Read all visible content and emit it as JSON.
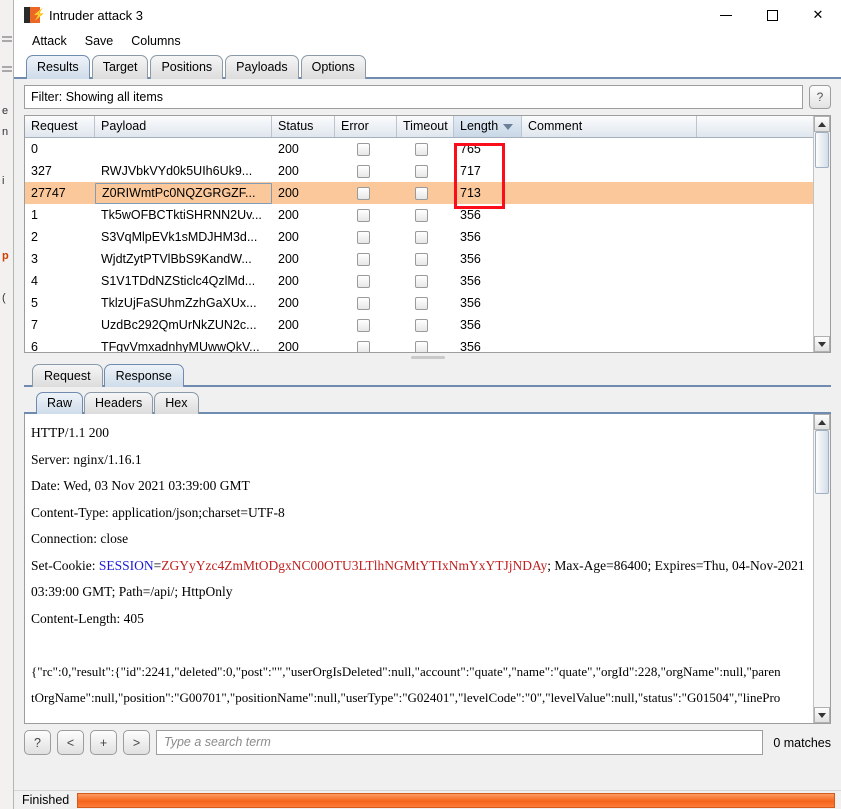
{
  "window": {
    "title": "Intruder attack 3",
    "app_icon": "burp-suite-icon",
    "minimize": "–",
    "maximize": "□",
    "close": "✕"
  },
  "menubar": {
    "items": [
      {
        "label": "Attack"
      },
      {
        "label": "Save"
      },
      {
        "label": "Columns"
      }
    ]
  },
  "main_tabs": [
    {
      "label": "Results",
      "active": true
    },
    {
      "label": "Target",
      "active": false
    },
    {
      "label": "Positions",
      "active": false
    },
    {
      "label": "Payloads",
      "active": false
    },
    {
      "label": "Options",
      "active": false
    }
  ],
  "filter": {
    "text": "Filter: Showing all items",
    "help_label": "?"
  },
  "results_table": {
    "columns": [
      {
        "label": "Request",
        "key": "request"
      },
      {
        "label": "Payload",
        "key": "payload"
      },
      {
        "label": "Status",
        "key": "status"
      },
      {
        "label": "Error",
        "key": "error"
      },
      {
        "label": "Timeout",
        "key": "timeout"
      },
      {
        "label": "Length",
        "key": "length",
        "sorted": true,
        "sort_dir": "desc"
      },
      {
        "label": "Comment",
        "key": "comment"
      }
    ],
    "rows": [
      {
        "request": "0",
        "payload": "",
        "status": "200",
        "length": "765",
        "comment": "",
        "selected": false
      },
      {
        "request": "327",
        "payload": "RWJVbkVYd0k5UIh6Uk9...",
        "status": "200",
        "length": "717",
        "comment": "",
        "selected": false
      },
      {
        "request": "27747",
        "payload": "Z0RIWmtPc0NQZGRGZF...",
        "status": "200",
        "length": "713",
        "comment": "",
        "selected": true
      },
      {
        "request": "1",
        "payload": "Tk5wOFBCTktiSHRNN2Uv...",
        "status": "200",
        "length": "356",
        "comment": "",
        "selected": false
      },
      {
        "request": "2",
        "payload": "S3VqMlpEVk1sMDJHM3d...",
        "status": "200",
        "length": "356",
        "comment": "",
        "selected": false
      },
      {
        "request": "3",
        "payload": "WjdtZytPTVlBbS9KandW...",
        "status": "200",
        "length": "356",
        "comment": "",
        "selected": false
      },
      {
        "request": "4",
        "payload": "S1V1TDdNZSticlc4QzlMd...",
        "status": "200",
        "length": "356",
        "comment": "",
        "selected": false
      },
      {
        "request": "5",
        "payload": "TklzUjFaSUhmZzhGaXUx...",
        "status": "200",
        "length": "356",
        "comment": "",
        "selected": false
      },
      {
        "request": "7",
        "payload": "UzdBc292QmUrNkZUN2c...",
        "status": "200",
        "length": "356",
        "comment": "",
        "selected": false
      },
      {
        "request": "6",
        "payload": "TFgvVmxadnhyMUwwQkV...",
        "status": "200",
        "length": "356",
        "comment": "",
        "selected": false
      }
    ],
    "annotation": {
      "color": "#fc0d1b",
      "target": "length-column-values"
    }
  },
  "message_tabs": [
    {
      "label": "Request",
      "active": false
    },
    {
      "label": "Response",
      "active": true
    }
  ],
  "view_tabs": [
    {
      "label": "Raw",
      "active": true
    },
    {
      "label": "Headers",
      "active": false
    },
    {
      "label": "Hex",
      "active": false
    }
  ],
  "response": {
    "status_line": "HTTP/1.1 200",
    "headers": [
      "Server: nginx/1.16.1",
      "Date: Wed, 03 Nov 2021 03:39:00 GMT",
      "Content-Type: application/json;charset=UTF-8",
      "Connection: close"
    ],
    "set_cookie": {
      "prefix": "Set-Cookie: ",
      "name": "SESSION",
      "eq": "=",
      "value": "ZGYyYzc4ZmMtODgxNC00OTU3LTlhNGMtYTIxNmYxYTJjNDAy",
      "suffix": "; Max-Age=86400; Expires=Thu, 04-Nov-2021",
      "line2": "03:39:00 GMT; Path=/api/; HttpOnly",
      "name_color": "#1a1ad6",
      "value_color": "#c02020"
    },
    "content_length": "Content-Length: 405",
    "body_lines": [
      "{\"rc\":0,\"result\":{\"id\":2241,\"deleted\":0,\"post\":\"\",\"userOrgIsDeleted\":null,\"account\":\"quate\",\"name\":\"quate\",\"orgId\":228,\"orgName\":null,\"paren",
      "tOrgName\":null,\"position\":\"G00701\",\"positionName\":null,\"userType\":\"G02401\",\"levelCode\":\"0\",\"levelValue\":null,\"status\":\"G01504\",\"linePro"
    ]
  },
  "search": {
    "help_label": "?",
    "prev_label": "<",
    "add_label": "+",
    "next_label": ">",
    "placeholder": "Type a search term",
    "value": "",
    "matches": "0 matches"
  },
  "status_bar": {
    "label": "Finished",
    "progress_percent": 100,
    "progress_color": "#f4641b"
  }
}
